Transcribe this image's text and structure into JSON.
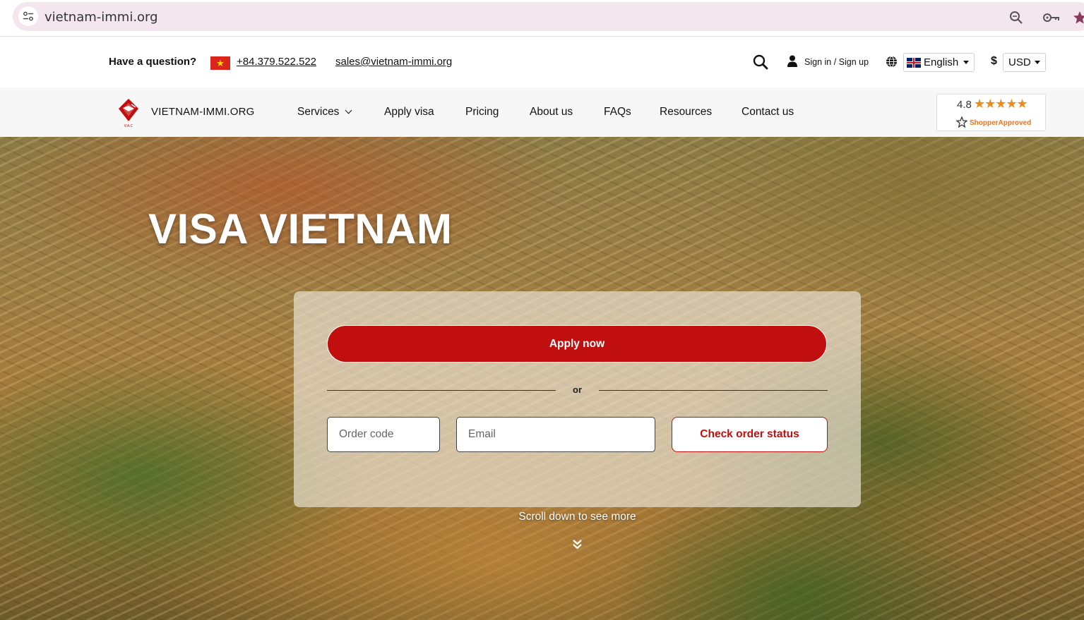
{
  "browser": {
    "url": "vietnam-immi.org"
  },
  "topbar": {
    "question": "Have a question?",
    "phone": "+84.379.522.522",
    "email": "sales@vietnam-immi.org",
    "signin": "Sign in / Sign up",
    "language": "English",
    "currency_symbol": "$",
    "currency": "USD"
  },
  "nav": {
    "brand": "VIETNAM-IMMI.ORG",
    "items": [
      "Services",
      "Apply visa",
      "Pricing",
      "About us",
      "FAQs",
      "Resources",
      "Contact us"
    ]
  },
  "rating": {
    "score": "4.8",
    "stars": "★★★★★",
    "provider": "ShopperApproved"
  },
  "hero": {
    "title": "VISA VIETNAM",
    "apply_label": "Apply now",
    "or_label": "or",
    "order_code_placeholder": "Order code",
    "email_placeholder": "Email",
    "check_label": "Check order status",
    "scroll_label": "Scroll down to see more"
  },
  "colors": {
    "brand_red": "#c10f0f",
    "url_bar": "#f4e6ef",
    "rating_orange": "#f08a18"
  }
}
